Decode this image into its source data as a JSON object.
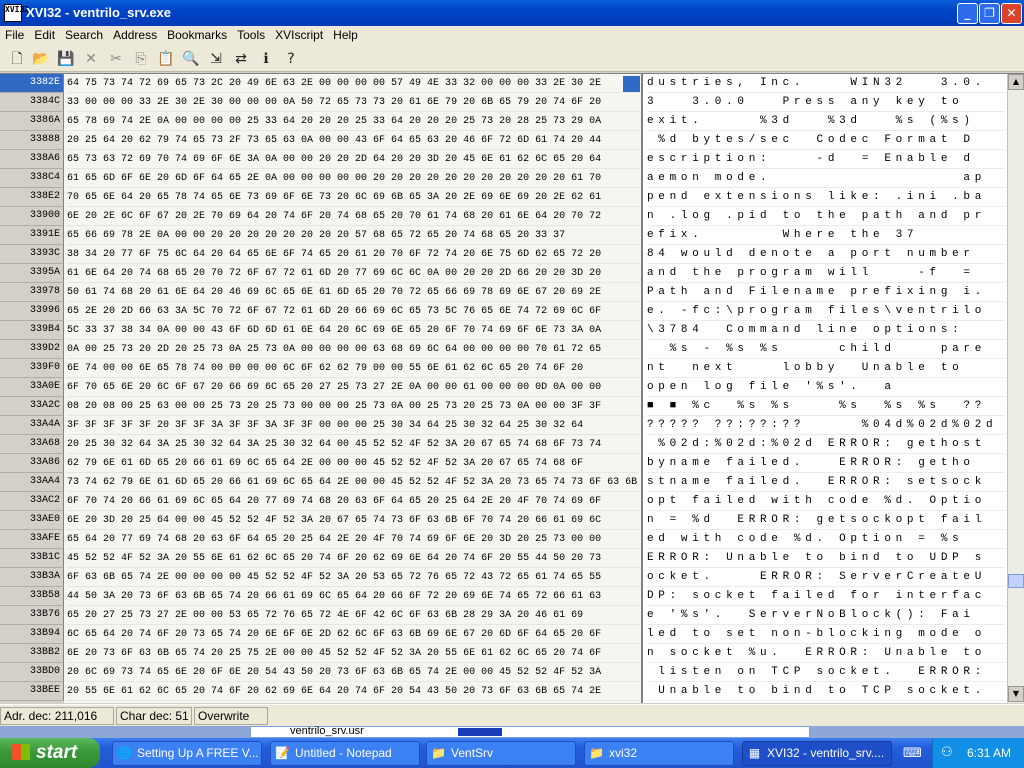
{
  "window": {
    "title": "XVI32 - ventrilo_srv.exe",
    "icon_text": "XVI32",
    "minimize_icon": "minimize-icon",
    "maximize_icon": "restore-icon",
    "close_icon": "close-icon"
  },
  "menu": [
    "File",
    "Edit",
    "Search",
    "Address",
    "Bookmarks",
    "Tools",
    "XVIscript",
    "Help"
  ],
  "toolbar": [
    "new-icon",
    "open-icon",
    "save-icon",
    "delete-icon",
    "cut-icon",
    "copy-icon",
    "paste-icon",
    "find-icon",
    "find-next-icon",
    "replace-icon",
    "info-icon",
    "help-icon"
  ],
  "editor": {
    "current_address": "3382E",
    "rows": [
      {
        "addr": "3382E",
        "hex": "64 75 73 74 72 69 65 73 2C 20 49 6E 63 2E 00 00 00 00 57 49 4E 33 32 00 00 00 33 2E 30 2E",
        "ascii": "dustries, Inc.    WIN32   3.0."
      },
      {
        "addr": "3384C",
        "hex": "33 00 00 00 33 2E 30 2E 30 00 00 00 0A 50 72 65 73 73 20 61 6E 79 20 6B 65 79 20 74 6F 20",
        "ascii": "3   3.0.0   Press any key to "
      },
      {
        "addr": "3386A",
        "hex": "65 78 69 74 2E 0A 00 00 00 00 25 33 64 20 20 20 25 33 64 20 20 20 25 73 20 28 25 73 29 0A",
        "ascii": "exit.     %3d   %3d   %s (%s)"
      },
      {
        "addr": "33888",
        "hex": "20 25 64 20 62 79 74 65 73 2F 73 65 63 0A 00 00 43 6F 64 65 63 20 46 6F 72 6D 61 74 20 44",
        "ascii": " %d bytes/sec  Codec Format D"
      },
      {
        "addr": "338A6",
        "hex": "65 73 63 72 69 70 74 69 6F 6E 3A 0A 00 00 20 20 2D 64 20 20 3D 20 45 6E 61 62 6C 65 20 64",
        "ascii": "escription:    -d  = Enable d"
      },
      {
        "addr": "338C4",
        "hex": "61 65 6D 6F 6E 20 6D 6F 64 65 2E 0A 00 00 00 00 00 20 20 20 20 20 20 20 20 20 20 20 61 70",
        "ascii": "aemon mode.                 ap"
      },
      {
        "addr": "338E2",
        "hex": "70 65 6E 64 20 65 78 74 65 6E 73 69 6F 6E 73 20 6C 69 6B 65 3A 20 2E 69 6E 69 20 2E 62 61",
        "ascii": "pend extensions like: .ini .ba"
      },
      {
        "addr": "33900",
        "hex": "6E 20 2E 6C 6F 67 20 2E 70 69 64 20 74 6F 20 74 68 65 20 70 61 74 68 20 61 6E 64 20 70 72",
        "ascii": "n .log .pid to the path and pr"
      },
      {
        "addr": "3391E",
        "hex": "65 66 69 78 2E 0A 00 00 20 20 20 20 20 20 20 20 57 68 65 72 65 20 74 68 65 20 33 37",
        "ascii": "efix.       Where the 37"
      },
      {
        "addr": "3393C",
        "hex": "38 34 20 77 6F 75 6C 64 20 64 65 6E 6F 74 65 20 61 20 70 6F 72 74 20 6E 75 6D 62 65 72 20",
        "ascii": "84 would denote a port number "
      },
      {
        "addr": "3395A",
        "hex": "61 6E 64 20 74 68 65 20 70 72 6F 67 72 61 6D 20 77 69 6C 6C 0A 00 20 20 2D 66 20 20 3D 20",
        "ascii": "and the program will    -f  = "
      },
      {
        "addr": "33978",
        "hex": "50 61 74 68 20 61 6E 64 20 46 69 6C 65 6E 61 6D 65 20 70 72 65 66 69 78 69 6E 67 20 69 2E",
        "ascii": "Path and Filename prefixing i."
      },
      {
        "addr": "33996",
        "hex": "65 2E 20 2D 66 63 3A 5C 70 72 6F 67 72 61 6D 20 66 69 6C 65 73 5C 76 65 6E 74 72 69 6C 6F",
        "ascii": "e. -fc:\\program files\\ventrilo"
      },
      {
        "addr": "339B4",
        "hex": "5C 33 37 38 34 0A 00 00 43 6F 6D 6D 61 6E 64 20 6C 69 6E 65 20 6F 70 74 69 6F 6E 73 3A 0A",
        "ascii": "\\3784  Command line options:"
      },
      {
        "addr": "339D2",
        "hex": "0A 00 25 73 20 2D 20 25 73 0A 25 73 0A 00 00 00 00 63 68 69 6C 64 00 00 00 00 70 61 72 65",
        "ascii": "  %s - %s %s     child    pare"
      },
      {
        "addr": "339F0",
        "hex": "6E 74 00 00 6E 65 78 74 00 00 00 00 6C 6F 62 62 79 00 00 55 6E 61 62 6C 65 20 74 6F 20",
        "ascii": "nt  next    lobby  Unable to "
      },
      {
        "addr": "33A0E",
        "hex": "6F 70 65 6E 20 6C 6F 67 20 66 69 6C 65 20 27 25 73 27 2E 0A 00 00 61 00 00 00 0D 0A 00 00",
        "ascii": "open log file '%s'.  a       "
      },
      {
        "addr": "33A2C",
        "hex": "08 20 08 00 25 63 00 00 25 73 20 25 73 00 00 00 25 73 0A 00 25 73 20 25 73 0A 00 00 3F 3F",
        "ascii": "■ ■ %c  %s %s    %s  %s %s  ??"
      },
      {
        "addr": "33A4A",
        "hex": "3F 3F 3F 3F 3F 20 3F 3F 3A 3F 3F 3A 3F 3F 00 00 00 25 30 34 64 25 30 32 64 25 30 32 64",
        "ascii": "????? ??:??:??     %04d%02d%02d"
      },
      {
        "addr": "33A68",
        "hex": "20 25 30 32 64 3A 25 30 32 64 3A 25 30 32 64 00 45 52 52 4F 52 3A 20 67 65 74 68 6F 73 74",
        "ascii": " %02d:%02d:%02d ERROR: gethost"
      },
      {
        "addr": "33A86",
        "hex": "62 79 6E 61 6D 65 20 66 61 69 6C 65 64 2E 00 00 00 45 52 52 4F 52 3A 20 67 65 74 68 6F",
        "ascii": "byname failed.   ERROR: getho"
      },
      {
        "addr": "33AA4",
        "hex": "73 74 62 79 6E 61 6D 65 20 66 61 69 6C 65 64 2E 00 00 45 52 52 4F 52 3A 20 73 65 74 73 6F 63 6B",
        "ascii": "stname failed.  ERROR: setsock"
      },
      {
        "addr": "33AC2",
        "hex": "6F 70 74 20 66 61 69 6C 65 64 20 77 69 74 68 20 63 6F 64 65 20 25 64 2E 20 4F 70 74 69 6F",
        "ascii": "opt failed with code %d. Optio"
      },
      {
        "addr": "33AE0",
        "hex": "6E 20 3D 20 25 64 00 00 45 52 52 4F 52 3A 20 67 65 74 73 6F 63 6B 6F 70 74 20 66 61 69 6C",
        "ascii": "n = %d  ERROR: getsockopt fail"
      },
      {
        "addr": "33AFE",
        "hex": "65 64 20 77 69 74 68 20 63 6F 64 65 20 25 64 2E 20 4F 70 74 69 6F 6E 20 3D 20 25 73 00 00",
        "ascii": "ed with code %d. Option = %s  "
      },
      {
        "addr": "33B1C",
        "hex": "45 52 52 4F 52 3A 20 55 6E 61 62 6C 65 20 74 6F 20 62 69 6E 64 20 74 6F 20 55 44 50 20 73",
        "ascii": "ERROR: Unable to bind to UDP s"
      },
      {
        "addr": "33B3A",
        "hex": "6F 63 6B 65 74 2E 00 00 00 00 45 52 52 4F 52 3A 20 53 65 72 76 65 72 43 72 65 61 74 65 55",
        "ascii": "ocket.    ERROR: ServerCreateU"
      },
      {
        "addr": "33B58",
        "hex": "44 50 3A 20 73 6F 63 6B 65 74 20 66 61 69 6C 65 64 20 66 6F 72 20 69 6E 74 65 72 66 61 63",
        "ascii": "DP: socket failed for interfac"
      },
      {
        "addr": "33B76",
        "hex": "65 20 27 25 73 27 2E 00 00 53 65 72 76 65 72 4E 6F 42 6C 6F 63 6B 28 29 3A 20 46 61 69",
        "ascii": "e '%s'.  ServerNoBlock(): Fai"
      },
      {
        "addr": "33B94",
        "hex": "6C 65 64 20 74 6F 20 73 65 74 20 6E 6F 6E 2D 62 6C 6F 63 6B 69 6E 67 20 6D 6F 64 65 20 6F",
        "ascii": "led to set non-blocking mode o"
      },
      {
        "addr": "33BB2",
        "hex": "6E 20 73 6F 63 6B 65 74 20 25 75 2E 00 00 45 52 52 4F 52 3A 20 55 6E 61 62 6C 65 20 74 6F",
        "ascii": "n socket %u.  ERROR: Unable to"
      },
      {
        "addr": "33BD0",
        "hex": "20 6C 69 73 74 65 6E 20 6F 6E 20 54 43 50 20 73 6F 63 6B 65 74 2E 00 00 45 52 52 4F 52 3A",
        "ascii": " listen on TCP socket.  ERROR:"
      },
      {
        "addr": "33BEE",
        "hex": "20 55 6E 61 62 6C 65 20 74 6F 20 62 69 6E 64 20 74 6F 20 54 43 50 20 73 6F 63 6B 65 74 2E",
        "ascii": " Unable to bind to TCP socket."
      }
    ]
  },
  "status": {
    "address": "Adr. dec: 211,016",
    "char": "Char dec: 51",
    "mode": "Overwrite"
  },
  "background_window": {
    "file": "ventrilo_srv.usr"
  },
  "taskbar": {
    "start": "start",
    "tasks": [
      {
        "label": "Setting Up A FREE V...",
        "icon": "browser-icon"
      },
      {
        "label": "Untitled - Notepad",
        "icon": "notepad-icon"
      },
      {
        "label": "VentSrv",
        "icon": "folder-icon"
      },
      {
        "label": "xvi32",
        "icon": "folder-icon"
      },
      {
        "label": "XVI32 - ventrilo_srv....",
        "icon": "hex-editor-icon"
      }
    ],
    "clock": "6:31 AM"
  }
}
